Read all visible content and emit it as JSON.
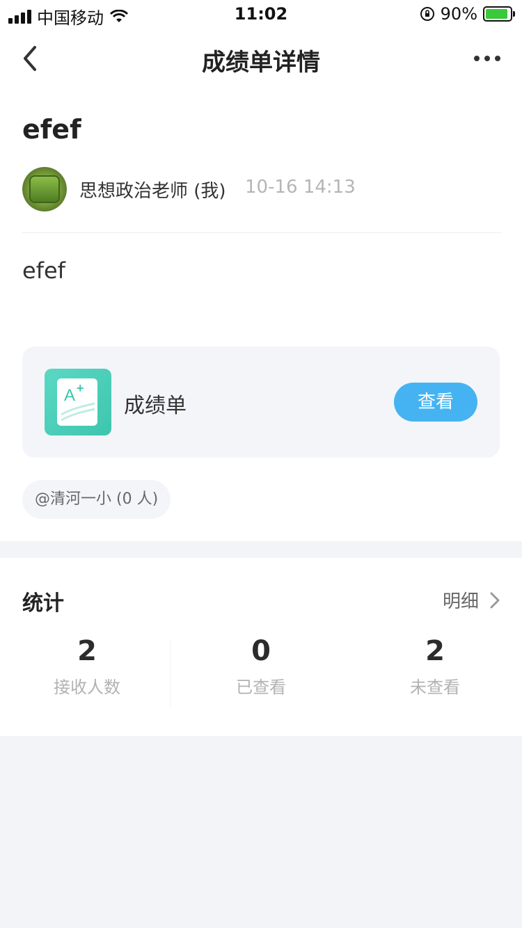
{
  "status_bar": {
    "carrier": "中国移动",
    "time": "11:02",
    "battery": "90%",
    "battery_level": 0.9
  },
  "nav": {
    "title": "成绩单详情",
    "back_icon": "chevron-left-icon",
    "more_icon": "more-horizontal-icon"
  },
  "post": {
    "title": "efef",
    "author": "思想政治老师 (我)",
    "time": "10-16 14:13",
    "body": "efef"
  },
  "attachment": {
    "label": "成绩单",
    "icon": "grade-sheet-icon",
    "action": "查看",
    "icon_letter": "A",
    "icon_sup": "+"
  },
  "tag": {
    "text": "@清河一小 (0 人)"
  },
  "stats": {
    "title": "统计",
    "detail": "明细",
    "items": [
      {
        "value": "2",
        "label": "接收人数"
      },
      {
        "value": "0",
        "label": "已查看"
      },
      {
        "value": "2",
        "label": "未查看"
      }
    ]
  },
  "colors": {
    "accent": "#45b3f1",
    "attachment_icon": "#3ec5ae",
    "background": "#f3f4f8"
  }
}
